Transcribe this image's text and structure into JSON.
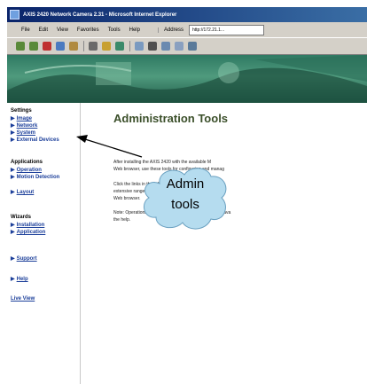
{
  "window": {
    "title": "AXIS 2420 Network Camera 2.31 - Microsoft Internet Explorer"
  },
  "menubar": {
    "items": [
      "File",
      "Edit",
      "View",
      "Favorites",
      "Tools",
      "Help"
    ],
    "address_label": "Address",
    "address_value": "http://172.21.1..."
  },
  "sidebar": {
    "settings_header": "Settings",
    "settings_items": [
      "Image",
      "Network",
      "System",
      "External Devices"
    ],
    "applications_header": "Applications",
    "applications_items": [
      "Operation",
      "Motion Detection",
      "Layout"
    ],
    "wizards_header": "Wizards",
    "wizards_items": [
      "Installation",
      "Application"
    ],
    "support": "Support",
    "help": "Help",
    "live_view": "Live View"
  },
  "main": {
    "title": "Administration Tools",
    "para1_line1": "After installing the AXIS 2420 with the available M",
    "para1_line2": "Web browser, use these tools for configuring and manag",
    "para2_line1": "Click the links in the left column to navigate your way a",
    "para2_line2": "extensive range of tools to easily configure and manag",
    "para2_line3": "Web browser.",
    "note_line1": "Note: Operational information for each supported tool is ava",
    "note_line2": "the help."
  },
  "annotation": {
    "line1": "Admin",
    "line2": "tools"
  }
}
